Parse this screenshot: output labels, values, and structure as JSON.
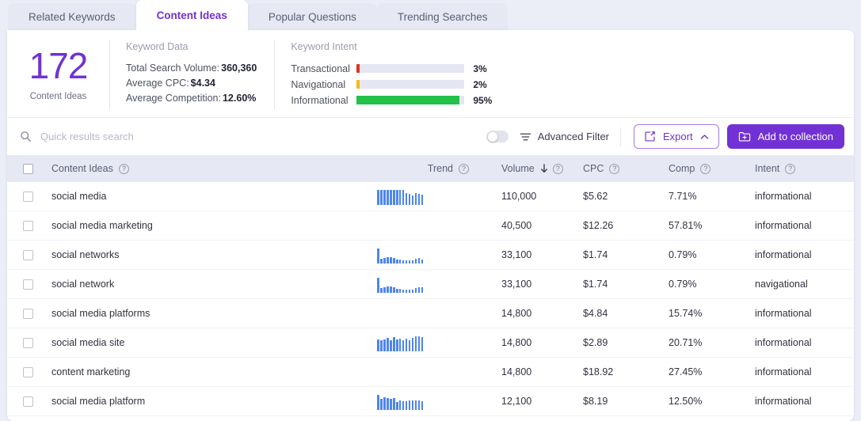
{
  "tabs": [
    {
      "label": "Related Keywords",
      "active": false
    },
    {
      "label": "Content Ideas",
      "active": true
    },
    {
      "label": "Popular Questions",
      "active": false
    },
    {
      "label": "Trending Searches",
      "active": false
    }
  ],
  "summary": {
    "count": "172",
    "count_label": "Content Ideas",
    "keyword_data": {
      "title": "Keyword Data",
      "rows": [
        {
          "label": "Total Search Volume:",
          "value": "360,360"
        },
        {
          "label": "Average CPC:",
          "value": "$4.34"
        },
        {
          "label": "Average Competition:",
          "value": "12.60%"
        }
      ]
    },
    "keyword_intent": {
      "title": "Keyword Intent",
      "rows": [
        {
          "name": "Transactional",
          "pct": "3%",
          "value": 3,
          "color": "#e0321c"
        },
        {
          "name": "Navigational",
          "pct": "2%",
          "value": 2,
          "color": "#fcb713"
        },
        {
          "name": "Informational",
          "pct": "95%",
          "value": 95,
          "color": "#22c14a"
        }
      ]
    }
  },
  "toolbar": {
    "search_placeholder": "Quick results search",
    "search_value": "",
    "advanced_filter_label": "Advanced Filter",
    "toggle_on": false,
    "export_label": "Export",
    "add_collection_label": "Add to collection"
  },
  "table": {
    "columns": [
      {
        "key": "keyword",
        "label": "Content Ideas",
        "help": true
      },
      {
        "key": "trend",
        "label": "Trend",
        "help": true
      },
      {
        "key": "volume",
        "label": "Volume",
        "help": true,
        "sorted": "desc"
      },
      {
        "key": "cpc",
        "label": "CPC",
        "help": true
      },
      {
        "key": "comp",
        "label": "Comp",
        "help": true
      },
      {
        "key": "intent",
        "label": "Intent",
        "help": true
      }
    ],
    "rows": [
      {
        "keyword": "social media",
        "volume": "110,000",
        "cpc": "$5.62",
        "comp": "7.71%",
        "intent": "informational",
        "trend": [
          19,
          19,
          19,
          19,
          19,
          19,
          19,
          19,
          19,
          15,
          14,
          12,
          15,
          14,
          13
        ]
      },
      {
        "keyword": "social media marketing",
        "volume": "40,500",
        "cpc": "$12.26",
        "comp": "57.81%",
        "intent": "informational",
        "trend": []
      },
      {
        "keyword": "social networks",
        "volume": "33,100",
        "cpc": "$1.74",
        "comp": "0.79%",
        "intent": "informational",
        "trend": [
          19,
          6,
          7,
          8,
          8,
          7,
          5,
          5,
          4,
          4,
          4,
          4,
          6,
          7,
          5
        ]
      },
      {
        "keyword": "social network",
        "volume": "33,100",
        "cpc": "$1.74",
        "comp": "0.79%",
        "intent": "navigational",
        "trend": [
          19,
          6,
          7,
          8,
          8,
          7,
          5,
          5,
          4,
          4,
          4,
          4,
          6,
          7,
          7
        ]
      },
      {
        "keyword": "social media platforms",
        "volume": "14,800",
        "cpc": "$4.84",
        "comp": "15.74%",
        "intent": "informational",
        "trend": []
      },
      {
        "keyword": "social media site",
        "volume": "14,800",
        "cpc": "$2.89",
        "comp": "20.71%",
        "intent": "informational",
        "trend": [
          15,
          14,
          15,
          17,
          14,
          18,
          15,
          16,
          14,
          16,
          14,
          17,
          19,
          19,
          18
        ]
      },
      {
        "keyword": "content marketing",
        "volume": "14,800",
        "cpc": "$18.92",
        "comp": "27.45%",
        "intent": "informational",
        "trend": []
      },
      {
        "keyword": "social media platform",
        "volume": "12,100",
        "cpc": "$8.19",
        "comp": "12.50%",
        "intent": "informational",
        "trend": [
          19,
          14,
          16,
          15,
          14,
          15,
          10,
          12,
          11,
          11,
          12,
          12,
          12,
          12,
          11
        ]
      }
    ]
  },
  "colors": {
    "brand": "#7231d4",
    "spark": "#4e86ee",
    "header_bg": "#e6e8f3"
  }
}
